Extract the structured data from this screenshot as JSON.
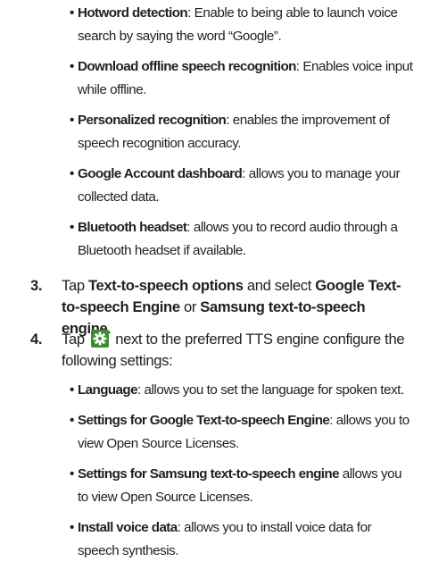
{
  "list1": [
    {
      "term": "Hotword detection",
      "desc": ": Enable to being able to launch voice search by saying the word “Google”."
    },
    {
      "term": "Download offline speech recognition",
      "desc": ": Enables voice input while offline."
    },
    {
      "term": "Personalized recognition",
      "desc": ": enables the improvement of speech recognition accuracy."
    },
    {
      "term": "Google Account dashboard",
      "desc": ": allows you to manage your collected data."
    },
    {
      "term": "Bluetooth headset",
      "desc": ": allows you to record audio through a Bluetooth headset if available."
    }
  ],
  "step3": {
    "number": "3.",
    "text_1": "Tap ",
    "bold_1": "Text-to-speech options",
    "text_2": " and select ",
    "bold_2": "Google Text-to-speech Engine",
    "text_3": " or ",
    "bold_3": "Samsung text-to-speech engine",
    "text_4": "."
  },
  "step4": {
    "number": "4.",
    "text_before_icon": "Tap ",
    "icon": "gear-icon",
    "text_after_icon": " next to the preferred TTS engine configure the following settings:"
  },
  "list2": [
    {
      "term": "Language",
      "desc": ": allows you to set the language for spoken text."
    },
    {
      "term": "Settings for Google Text-to-speech Engine",
      "desc": ": allows you to view Open Source Licenses."
    },
    {
      "term": "Settings for Samsung text-to-speech engine",
      "desc": " allows you to view Open Source Licenses."
    },
    {
      "term": "Install voice data",
      "desc": ": allows you to install voice data for speech synthesis."
    }
  ],
  "colors": {
    "text": "#231f20",
    "icon_bg": "#3c8c34"
  }
}
